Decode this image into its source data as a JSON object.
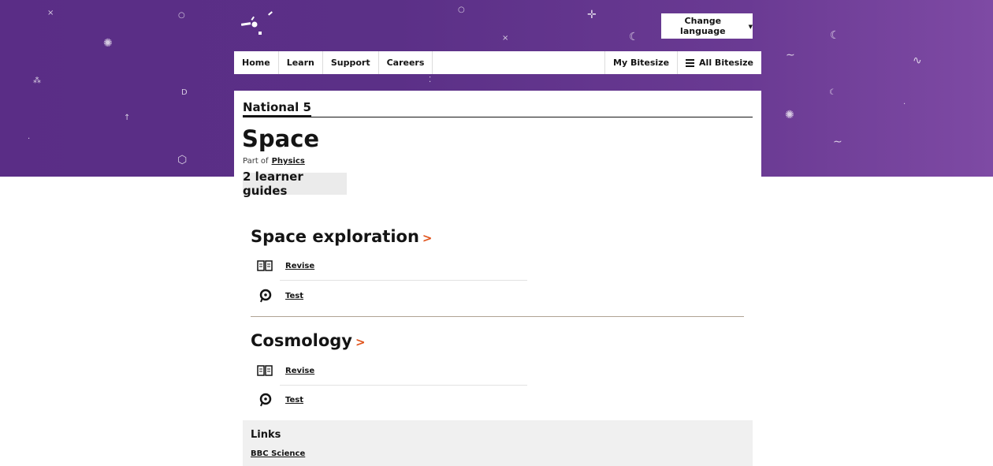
{
  "header": {
    "language_button": "Change language",
    "nav": {
      "home": "Home",
      "learn": "Learn",
      "support": "Support",
      "careers": "Careers",
      "my_bitesize": "My Bitesize",
      "all_bitesize": "All Bitesize"
    }
  },
  "page": {
    "level": "National 5",
    "title": "Space",
    "part_of_prefix": "Part of",
    "part_of_link": "Physics",
    "guides_count": "2 learner guides"
  },
  "guides": [
    {
      "title": "Space exploration",
      "revise": "Revise",
      "test": "Test"
    },
    {
      "title": "Cosmology",
      "revise": "Revise",
      "test": "Test"
    }
  ],
  "links": {
    "title": "Links",
    "items": [
      "BBC Science"
    ]
  },
  "icons": {
    "revise": "book-icon",
    "test": "quiz-icon",
    "chevron": "chevron-right-icon",
    "menu": "menu-icon",
    "caret": "caret-down-icon"
  },
  "colors": {
    "hero_start": "#5a2d86",
    "hero_end": "#7e4aa4",
    "accent": "#e0531b",
    "text": "#141414"
  }
}
